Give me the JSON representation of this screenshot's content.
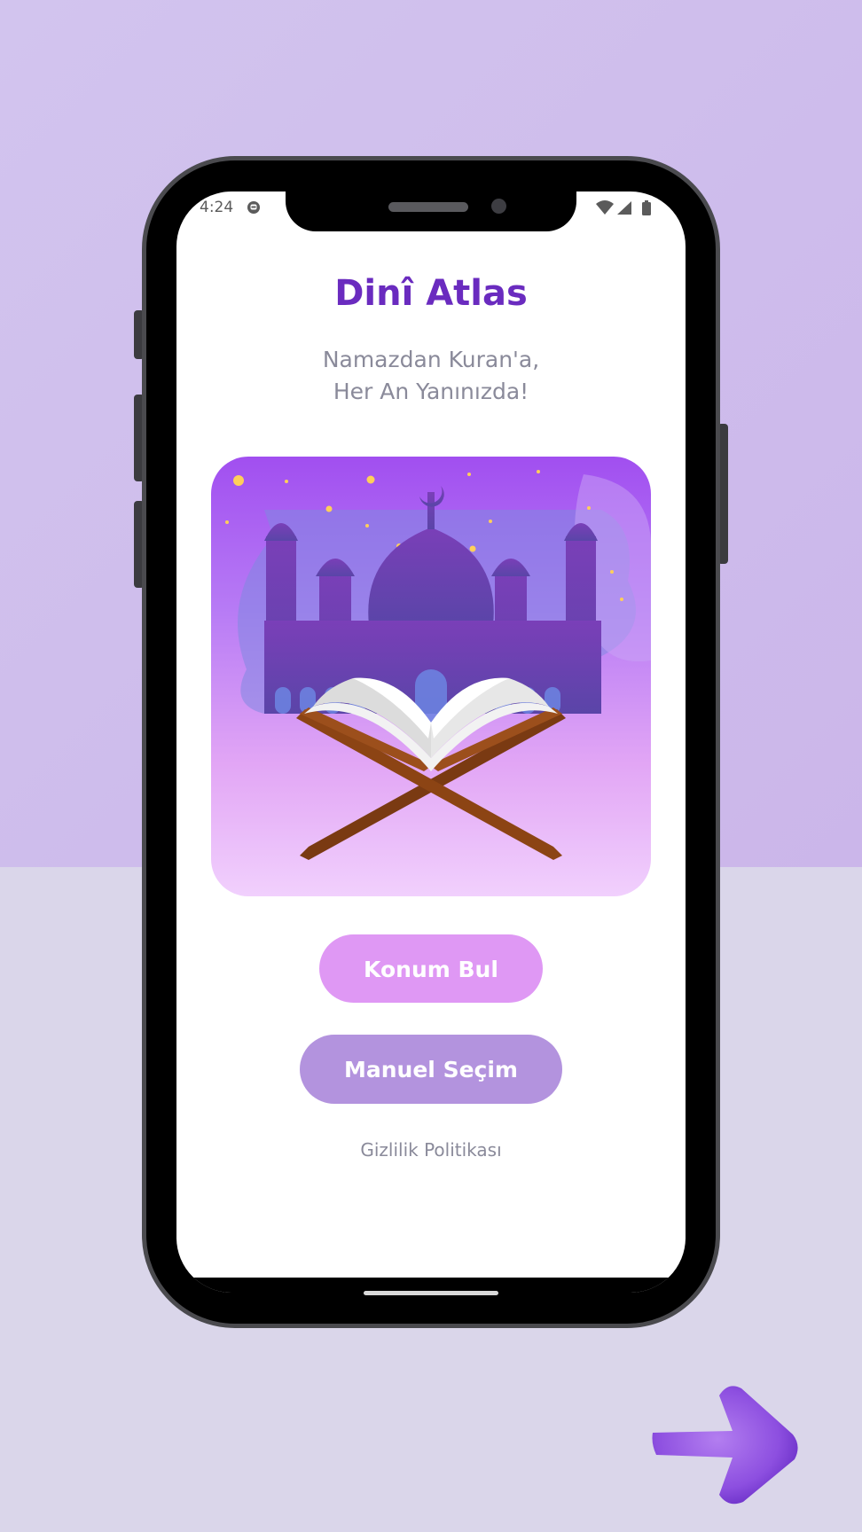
{
  "status_bar": {
    "time": "4:24"
  },
  "app": {
    "title": "Dinî Atlas",
    "subtitle_line1": "Namazdan Kuran'a,",
    "subtitle_line2": "Her An Yanınızda!"
  },
  "buttons": {
    "find_location": "Konum Bul",
    "manual_selection": "Manuel Seçim"
  },
  "links": {
    "privacy_policy": "Gizlilik Politikası"
  },
  "colors": {
    "title": "#6a2bbf",
    "button_primary": "#df98f4",
    "button_secondary": "#b393de",
    "muted_text": "#8a8a9a"
  },
  "icons": [
    "wifi-icon",
    "cellular-signal-icon",
    "battery-icon",
    "notification-icon",
    "right-arrow-icon"
  ]
}
